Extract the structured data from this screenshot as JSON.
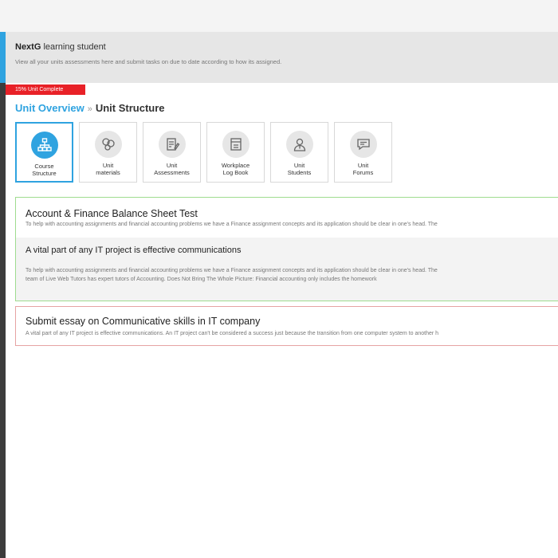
{
  "header": {
    "title_bold": "NextG",
    "title_rest": " learning student",
    "subtitle": "View all your units assessments here and submit tasks on due to date according to how its assigned."
  },
  "progress": {
    "label": "15% Unit Complete",
    "percent": 15
  },
  "breadcrumb": {
    "link": "Unit Overview",
    "separator": "»",
    "current": "Unit Structure"
  },
  "tiles": [
    {
      "line1": "Course",
      "line2": "Structure",
      "icon": "org-chart-icon",
      "active": true
    },
    {
      "line1": "Unit",
      "line2": "materials",
      "icon": "circles-icon",
      "active": false
    },
    {
      "line1": "Unit",
      "line2": "Assessments",
      "icon": "document-edit-icon",
      "active": false
    },
    {
      "line1": "Workplace",
      "line2": "Log Book",
      "icon": "logbook-icon",
      "active": false
    },
    {
      "line1": "Unit",
      "line2": "Students",
      "icon": "student-icon",
      "active": false
    },
    {
      "line1": "Unit",
      "line2": "Forums",
      "icon": "chat-icon",
      "active": false
    }
  ],
  "cards": {
    "finance": {
      "title": "Account & Finance Balance Sheet Test",
      "text": "To help with accounting assignments and financial accounting problems we have a Finance assignment concepts and its application should be clear in one's head. The",
      "sub_title": "A vital part of any IT project is effective communications",
      "sub_text1": "To help with accounting assignments and financial accounting problems we have a Finance assignment concepts and its application should be clear in one's head. The",
      "sub_text2": "team of Live Web Tutors has expert tutors of Accounting.  Does Not Bring The Whole Picture: Financial accounting only includes the homework"
    },
    "essay": {
      "title": "Submit essay on Communicative skills in IT company",
      "text": "A vital part of any IT project is effective communications. An IT project can't be considered a success just because the transition from one computer system to another h"
    }
  },
  "colors": {
    "accent": "#2fa3e0",
    "progress": "#e82127",
    "green_border": "#9fdc8f",
    "red_border": "#e6a3a3"
  }
}
